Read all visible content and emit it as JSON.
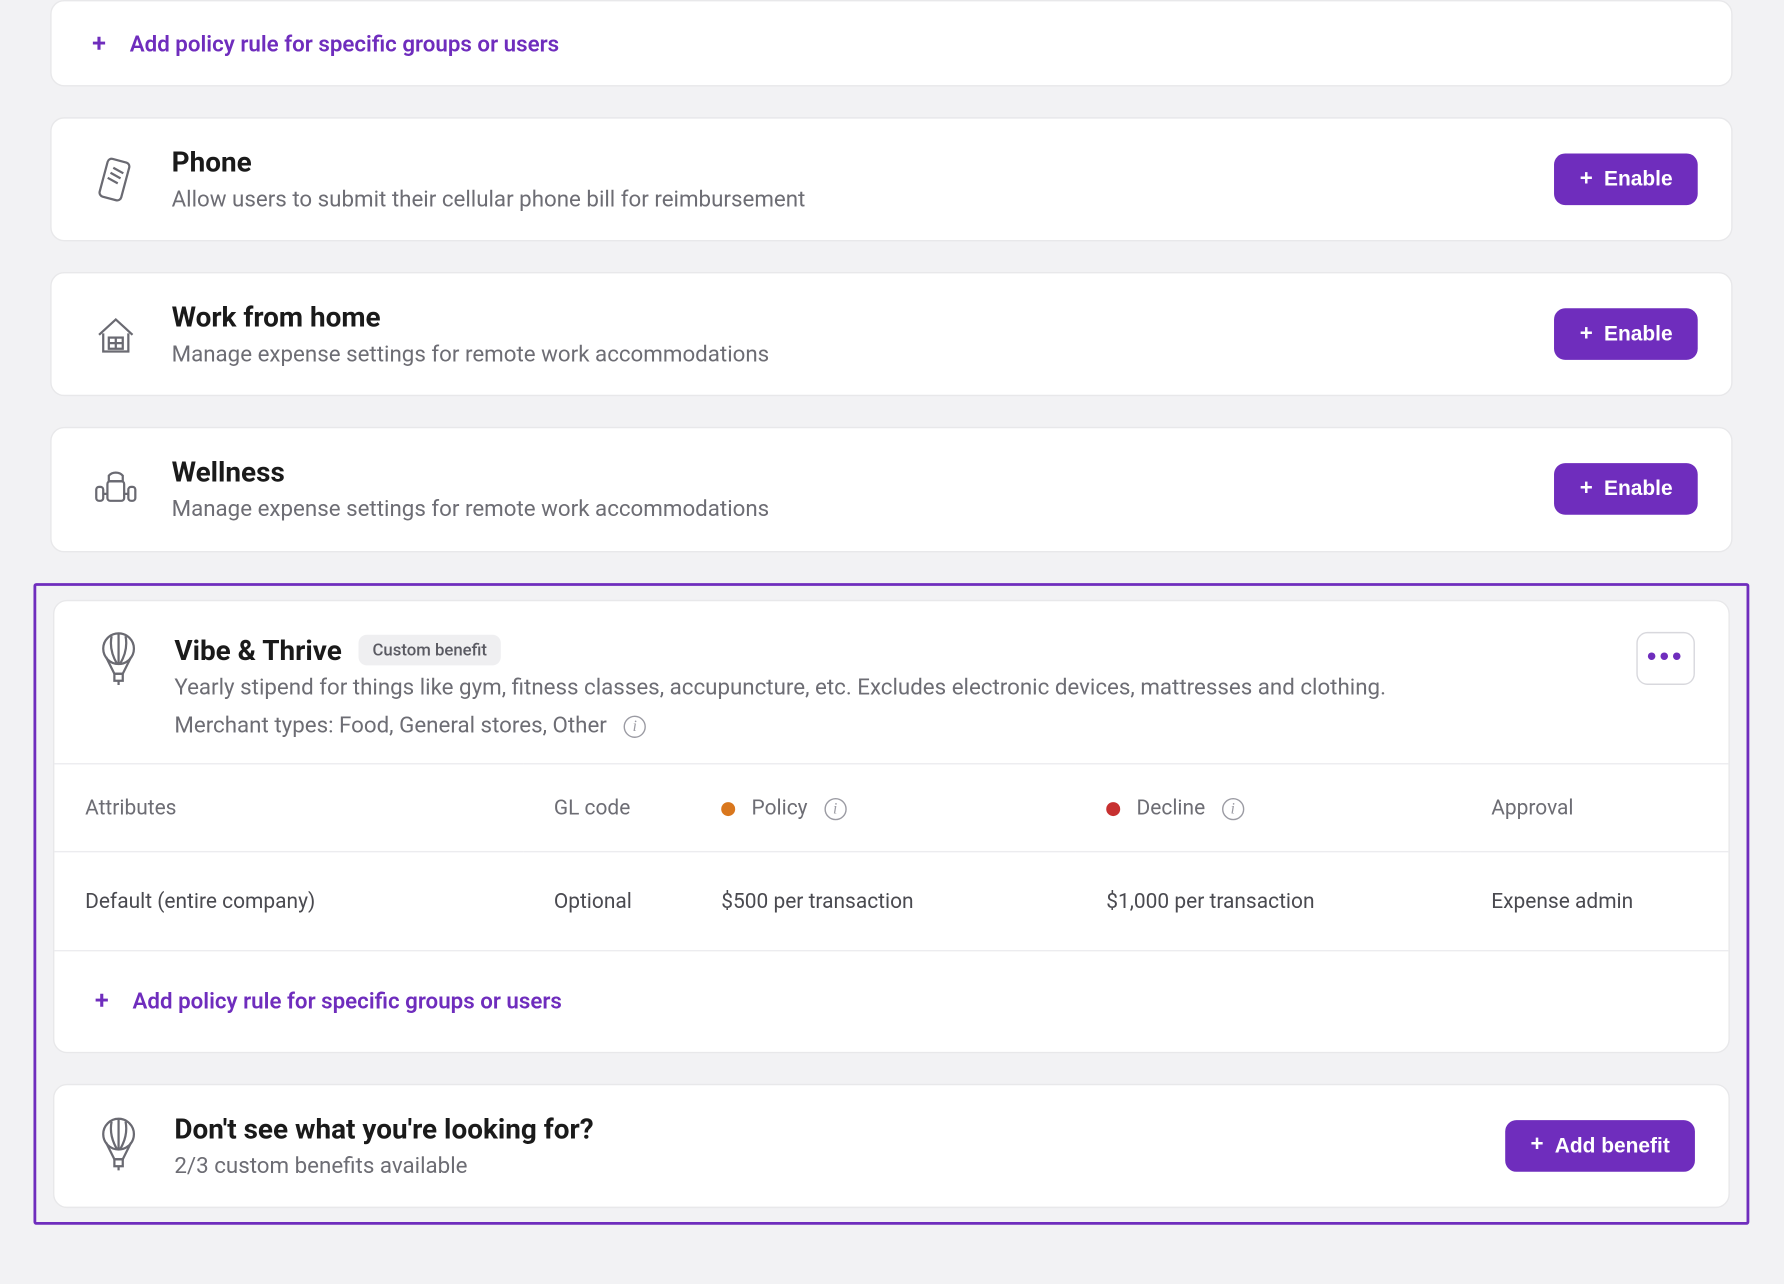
{
  "colors": {
    "accent": "#6f2dbd",
    "policyDot": "#d9771d",
    "declineDot": "#c73030"
  },
  "topAddRule": {
    "label": "Add policy rule for specific groups or users"
  },
  "benefits": [
    {
      "title": "Phone",
      "subtitle": "Allow users to submit their cellular phone bill for reimbursement",
      "enableLabel": "Enable"
    },
    {
      "title": "Work from home",
      "subtitle": "Manage expense settings for remote work accommodations",
      "enableLabel": "Enable"
    },
    {
      "title": "Wellness",
      "subtitle": "Manage expense settings for remote work accommodations",
      "enableLabel": "Enable"
    }
  ],
  "vibe": {
    "title": "Vibe & Thrive",
    "badge": "Custom benefit",
    "desc": "Yearly stipend for things like gym, fitness classes, accupuncture, etc. Excludes electronic devices, mattresses and clothing.",
    "merchants": "Merchant types: Food, General stores, Other",
    "columns": {
      "attributes": "Attributes",
      "glcode": "GL code",
      "policy": "Policy",
      "decline": "Decline",
      "approval": "Approval"
    },
    "row": {
      "attributes": "Default (entire company)",
      "glcode": "Optional",
      "policy": "$500 per transaction",
      "decline": "$1,000 per transaction",
      "approval": "Expense admin"
    },
    "addRule": "Add policy rule for specific groups or users"
  },
  "footer": {
    "title": "Don't see what you're looking for?",
    "subtitle": "2/3 custom benefits available",
    "buttonLabel": "Add benefit"
  }
}
